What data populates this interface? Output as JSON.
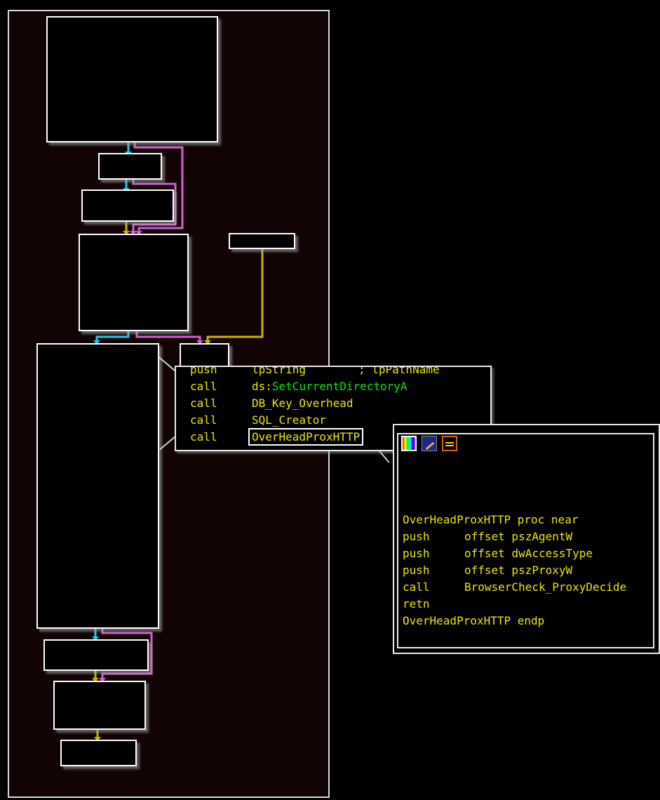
{
  "colors": {
    "background": "#000000",
    "panel_bg": "#120404",
    "border": "#ffffff",
    "edge_cyan": "#20c8e8",
    "edge_pink": "#d060d0",
    "edge_yellow": "#c8b400",
    "code_yellow": "#e8e800",
    "api_green": "#00e800"
  },
  "zoom_block": {
    "rows": [
      {
        "mnemonic": "push",
        "operand": "lpString",
        "comment": "; lpPathName"
      },
      {
        "mnemonic": "call",
        "prefix": "ds:",
        "api": "SetCurrentDirectoryA"
      },
      {
        "mnemonic": "call",
        "operand": "DB_Key_Overhead"
      },
      {
        "mnemonic": "call",
        "operand": "SQL_Creator"
      },
      {
        "mnemonic": "call",
        "operand": "OverHeadProxHTTP"
      }
    ]
  },
  "tooltip": {
    "toolbar_icons": [
      "palette-icon",
      "brush-icon",
      "terminal-icon"
    ],
    "lines": [
      {
        "mnemonic": "",
        "operand": "OverHeadProxHTTP proc near"
      },
      {
        "mnemonic": "push",
        "operand": "offset pszAgentW"
      },
      {
        "mnemonic": "push",
        "operand": "offset dwAccessType"
      },
      {
        "mnemonic": "push",
        "operand": "offset pszProxyW"
      },
      {
        "mnemonic": "call",
        "operand": "BrowserCheck_ProxyDecide"
      },
      {
        "mnemonic": "retn",
        "operand": ""
      },
      {
        "mnemonic": "",
        "operand": "OverHeadProxHTTP endp"
      }
    ]
  }
}
